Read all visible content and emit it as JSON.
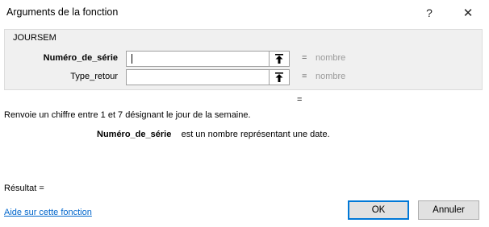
{
  "window": {
    "title": "Arguments de la fonction",
    "help_glyph": "?",
    "close_glyph": "✕"
  },
  "function": {
    "name": "JOURSEM",
    "arguments": [
      {
        "label": "Numéro_de_série",
        "value": "",
        "equals": "=",
        "result": "nombre",
        "bold": true
      },
      {
        "label": "Type_retour",
        "value": "",
        "equals": "=",
        "result": "nombre",
        "bold": false
      }
    ],
    "equals": "=",
    "description": "Renvoie un chiffre entre 1 et 7 désignant le jour de la semaine.",
    "arg_description": {
      "name": "Numéro_de_série",
      "text": "est un nombre représentant une date."
    }
  },
  "footer": {
    "result_label": "Résultat =",
    "help_link": "Aide sur cette fonction",
    "ok_label": "OK",
    "cancel_label": "Annuler"
  }
}
